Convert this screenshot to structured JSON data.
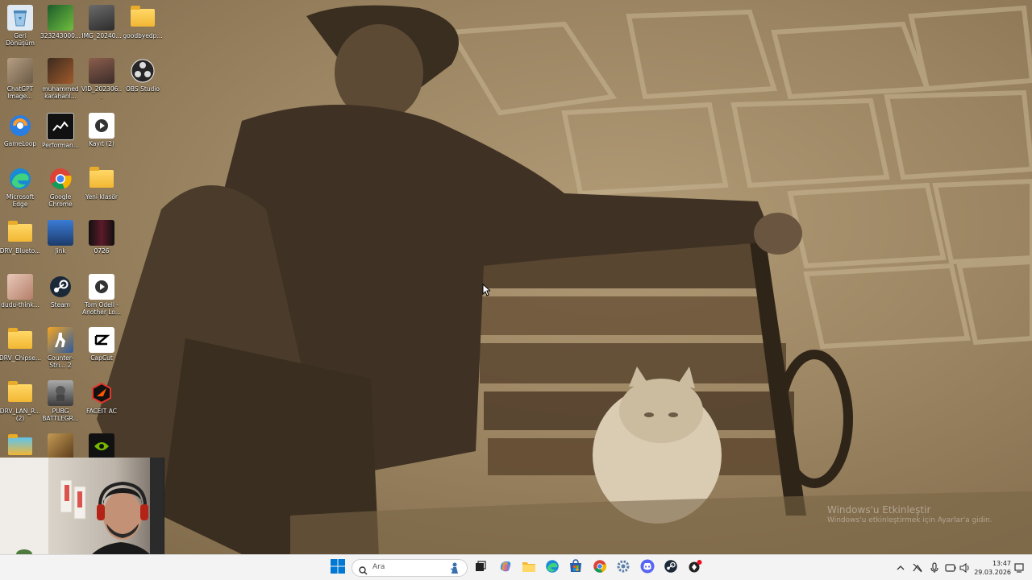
{
  "desktop": {
    "icons": [
      {
        "label": "Geri Dönüşüm Kutusu",
        "icon": "recycle-bin-icon"
      },
      {
        "label": "323243000...",
        "icon": "image-file-icon"
      },
      {
        "label": "IMG_20240...",
        "icon": "image-file-icon"
      },
      {
        "label": "goodbyedp...",
        "icon": "folder-icon"
      },
      {
        "label": "ChatGPT Image...",
        "icon": "image-file-icon"
      },
      {
        "label": "muhammed karahanl...",
        "icon": "image-file-icon"
      },
      {
        "label": "VID_202306...",
        "icon": "video-file-icon"
      },
      {
        "label": "OBS Studio",
        "icon": "obs-studio-icon"
      },
      {
        "label": "GameLoop",
        "icon": "gameloop-icon"
      },
      {
        "label": "Performan...",
        "icon": "performance-app-icon"
      },
      {
        "label": "Kayıt (2)",
        "icon": "video-file-icon"
      },
      {
        "label": "Microsoft Edge",
        "icon": "edge-icon"
      },
      {
        "label": "Google Chrome",
        "icon": "chrome-icon"
      },
      {
        "label": "Yeni klasör",
        "icon": "folder-icon"
      },
      {
        "label": "DRV_Blueto...",
        "icon": "folder-icon"
      },
      {
        "label": "Jink",
        "icon": "image-file-icon"
      },
      {
        "label": "0726",
        "icon": "image-file-icon"
      },
      {
        "label": "dudu-think...",
        "icon": "image-file-icon"
      },
      {
        "label": "Steam",
        "icon": "steam-icon"
      },
      {
        "label": "Tom Odell - Another Lo...",
        "icon": "video-file-icon"
      },
      {
        "label": "DRV_Chipse...",
        "icon": "folder-icon"
      },
      {
        "label": "Counter-Stri... 2",
        "icon": "counter-strike-icon"
      },
      {
        "label": "CapCut",
        "icon": "capcut-icon"
      },
      {
        "label": "DRV_LAN_R... (2)",
        "icon": "folder-icon"
      },
      {
        "label": "PUBG BATTLEGR...",
        "icon": "pubg-icon"
      },
      {
        "label": "FACEIT AC",
        "icon": "faceit-icon"
      },
      {
        "label": "",
        "icon": "folder-icon"
      },
      {
        "label": "",
        "icon": "game-app-icon"
      },
      {
        "label": "",
        "icon": "nvidia-icon"
      }
    ]
  },
  "watermark": {
    "line1": "Windows'u Etkinleştir",
    "line2": "Windows'u etkinleştirmek için Ayarlar'a gidin."
  },
  "taskbar": {
    "search_placeholder": "Ara",
    "pinned": [
      "start-icon",
      "task-view-icon",
      "copilot-icon",
      "file-explorer-icon",
      "edge-icon",
      "microsoft-store-icon",
      "chrome-icon",
      "settings-icon",
      "discord-icon",
      "steam-icon",
      "app-icon"
    ],
    "clock": {
      "time": "13:47",
      "date": "29.03.2026"
    }
  },
  "colors": {
    "taskbar_bg": "#f3f3f3",
    "wallpaper_tone": "#a58e6a",
    "start_blue": "#0078d4"
  }
}
